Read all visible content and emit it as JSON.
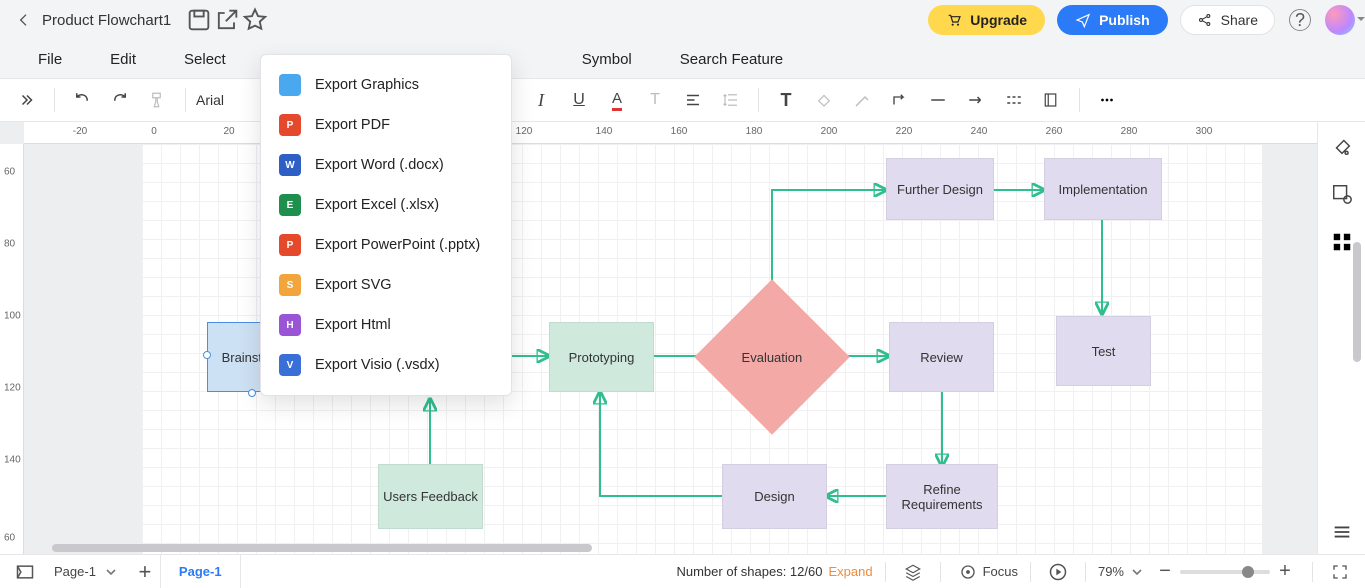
{
  "header": {
    "doc_title": "Product Flowchart1",
    "upgrade": "Upgrade",
    "publish": "Publish",
    "share": "Share"
  },
  "menubar": {
    "items": [
      "File",
      "Edit",
      "Select",
      "Symbol",
      "Search Feature"
    ]
  },
  "toolbar": {
    "font": "Arial"
  },
  "export_menu": {
    "items": [
      {
        "label": "Export Graphics",
        "color": "#4aa8ef",
        "glyph": ""
      },
      {
        "label": "Export PDF",
        "color": "#e4492c",
        "glyph": "P"
      },
      {
        "label": "Export Word (.docx)",
        "color": "#2d5fc4",
        "glyph": "W"
      },
      {
        "label": "Export Excel (.xlsx)",
        "color": "#1f8f4d",
        "glyph": "E"
      },
      {
        "label": "Export PowerPoint (.pptx)",
        "color": "#e4492c",
        "glyph": "P"
      },
      {
        "label": "Export SVG",
        "color": "#f2a53c",
        "glyph": "S"
      },
      {
        "label": "Export Html",
        "color": "#9a54d6",
        "glyph": "H"
      },
      {
        "label": "Export Visio (.vsdx)",
        "color": "#3b6fd8",
        "glyph": "V"
      }
    ]
  },
  "ruler_h": {
    "ticks": [
      -20,
      0,
      20,
      120,
      140,
      160,
      180,
      200,
      220,
      240,
      260,
      280,
      300
    ]
  },
  "ruler_v": {
    "ticks": [
      60,
      80,
      100,
      120,
      140,
      60
    ]
  },
  "nodes": {
    "brainstorm": {
      "label": "Brainstorm"
    },
    "prototyping": {
      "label": "Prototyping"
    },
    "evaluation": {
      "label": "Evaluation"
    },
    "review": {
      "label": "Review"
    },
    "further": {
      "label": "Further Design"
    },
    "implementation": {
      "label": "Implementation"
    },
    "test": {
      "label": "Test"
    },
    "refine": {
      "label": "Refine Requirements"
    },
    "design": {
      "label": "Design"
    },
    "feedback": {
      "label": "Users Feedback"
    }
  },
  "status": {
    "page_dropdown": "Page-1",
    "page_tab": "Page-1",
    "shapes": "Number of shapes: 12/60",
    "expand": "Expand",
    "focus": "Focus",
    "zoom": "79%"
  }
}
